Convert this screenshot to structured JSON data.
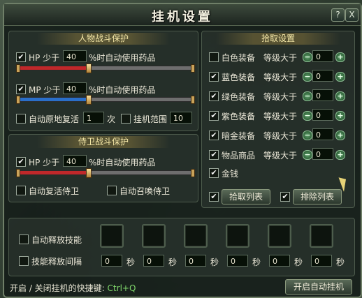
{
  "title": "挂机设置",
  "controls": {
    "help": "?",
    "close": "X"
  },
  "char_protect": {
    "title": "人物战斗保护",
    "hp": {
      "checked": true,
      "label_a": "HP 少于",
      "value": "40",
      "label_b": "%时自动使用药品",
      "percent": 40
    },
    "mp": {
      "checked": true,
      "label_a": "MP 少于",
      "value": "40",
      "label_b": "%时自动使用药品",
      "percent": 40
    },
    "revive": {
      "checked": false,
      "label": "自动原地复活",
      "value": "1",
      "unit": "次"
    },
    "range": {
      "checked": false,
      "label": "挂机范围",
      "value": "10"
    }
  },
  "guard_protect": {
    "title": "侍卫战斗保护",
    "hp": {
      "checked": true,
      "label_a": "HP 少于",
      "value": "40",
      "label_b": "%时自动使用药品",
      "percent": 40
    },
    "revive": {
      "checked": false,
      "label": "自动复活侍卫"
    },
    "summon": {
      "checked": false,
      "label": "自动召唤侍卫"
    }
  },
  "pickup": {
    "title": "拾取设置",
    "level_label": "等级大于",
    "items": [
      {
        "label": "白色装备",
        "checked": false,
        "value": "0"
      },
      {
        "label": "蓝色装备",
        "checked": true,
        "value": "0"
      },
      {
        "label": "绿色装备",
        "checked": true,
        "value": "0"
      },
      {
        "label": "紫色装备",
        "checked": true,
        "value": "0"
      },
      {
        "label": "暗金装备",
        "checked": true,
        "value": "0"
      },
      {
        "label": "物品商品",
        "checked": true,
        "value": "0"
      }
    ],
    "money": {
      "label": "金钱",
      "checked": true
    },
    "pickup_list": {
      "label": "拾取列表",
      "checked": true
    },
    "exclude_list": {
      "label": "排除列表",
      "checked": true
    }
  },
  "skills": {
    "auto_label": "自动释放技能",
    "auto_checked": false,
    "interval_label": "技能释放间隔",
    "interval_checked": false,
    "unit": "秒",
    "intervals": [
      "0",
      "0",
      "0",
      "0",
      "0",
      "0"
    ]
  },
  "footer": {
    "hint": "开启 / 关闭挂机的快捷键:",
    "shortcut": "Ctrl+Q",
    "start_button": "开启自动挂机"
  },
  "colors": {
    "hp": "#c0282a",
    "mp": "#2a6fc9",
    "accent": "#f6e9a8"
  }
}
